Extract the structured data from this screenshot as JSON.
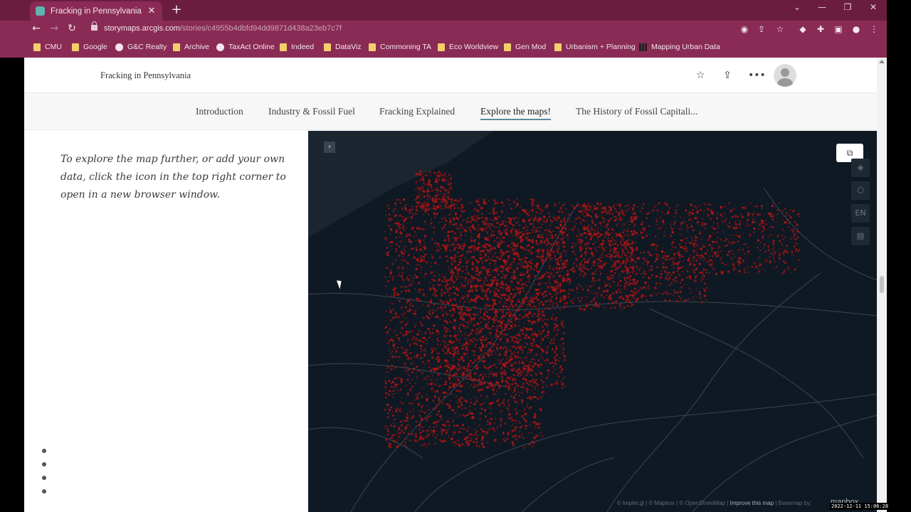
{
  "browser": {
    "tab_title": "Fracking in Pennsylvania",
    "tab_close": "✕",
    "new_tab": "+",
    "url_host": "storymaps.arcgis.com",
    "url_path": "/stories/c4955b4dbfd94dd9871d438a23eb7c7f",
    "bookmarks": [
      {
        "label": "CMU",
        "icon": "folder-icon"
      },
      {
        "label": "Google",
        "icon": "folder-icon"
      },
      {
        "label": "G&C Realty",
        "icon": "globe-icon"
      },
      {
        "label": "Archive",
        "icon": "folder-icon"
      },
      {
        "label": "TaxAct Online",
        "icon": "globe-icon"
      },
      {
        "label": "Indeed",
        "icon": "folder-icon"
      },
      {
        "label": "DataViz",
        "icon": "folder-icon"
      },
      {
        "label": "Commoning TA",
        "icon": "folder-icon"
      },
      {
        "label": "Eco Worldview",
        "icon": "folder-icon"
      },
      {
        "label": "Gen Mod",
        "icon": "folder-icon"
      },
      {
        "label": "Urbanism + Planning",
        "icon": "folder-icon"
      },
      {
        "label": "Mapping Urban Data",
        "icon": "chart-icon"
      }
    ]
  },
  "story": {
    "title": "Fracking in Pennsylvania",
    "nav": [
      {
        "label": "Introduction"
      },
      {
        "label": "Industry & Fossil Fuel"
      },
      {
        "label": "Fracking Explained"
      },
      {
        "label": "Explore the maps!",
        "active": true
      },
      {
        "label": "The History of Fossil Capitali..."
      }
    ],
    "side_text": "To explore the map further, or add your own data, click the icon in the top right corner to open in a new browser window."
  },
  "map": {
    "control_language": "EN",
    "attribution_prefix": "© kepler.gl | © Mapbox | © OpenStreetMap | ",
    "attribution_link": "Improve this map",
    "attribution_suffix": " | Basemap by:",
    "logo": "mapbox",
    "colors": {
      "background": "#0f1923",
      "wells": "#b31414",
      "roads": "#3a4654"
    }
  },
  "overlay": {
    "timestamp": "2022-12-11  15:06:28"
  }
}
